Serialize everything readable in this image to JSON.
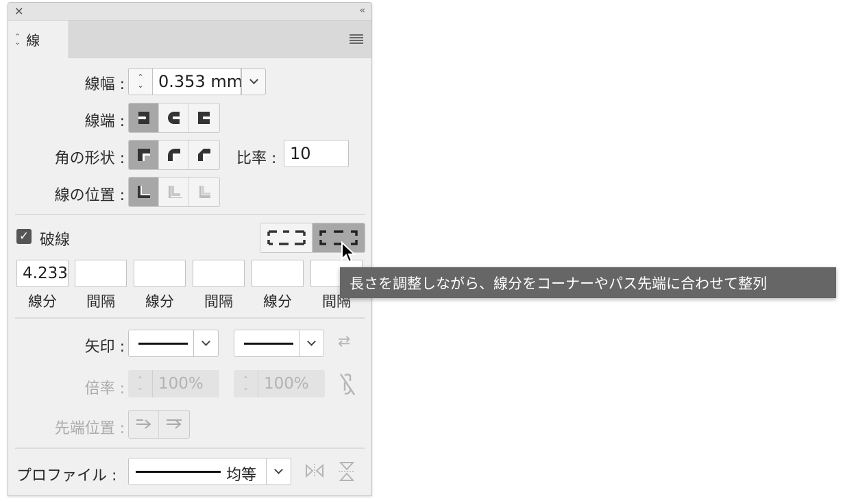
{
  "panel": {
    "tab_label": "線"
  },
  "stroke": {
    "weight_label": "線幅 :",
    "weight_value": "0.353 mm",
    "cap_label": "線端 :",
    "corner_label": "角の形状 :",
    "limit_label": "比率 :",
    "limit_value": "10",
    "align_label": "線の位置 :"
  },
  "dashed": {
    "label": "破線",
    "checked": true,
    "fields": [
      {
        "value": "4.233",
        "label": "線分"
      },
      {
        "value": "",
        "label": "間隔"
      },
      {
        "value": "",
        "label": "線分"
      },
      {
        "value": "",
        "label": "間隔"
      },
      {
        "value": "",
        "label": "線分"
      },
      {
        "value": "",
        "label": "間隔"
      }
    ]
  },
  "arrows": {
    "label": "矢印 :",
    "scale_label": "倍率 :",
    "scale_start": "100%",
    "scale_end": "100%",
    "align_label": "先端位置 :"
  },
  "profile": {
    "label": "プロファイル :",
    "value": "均等"
  },
  "tooltip": {
    "text": "長さを調整しながら、線分をコーナーやパス先端に合わせて整列"
  }
}
